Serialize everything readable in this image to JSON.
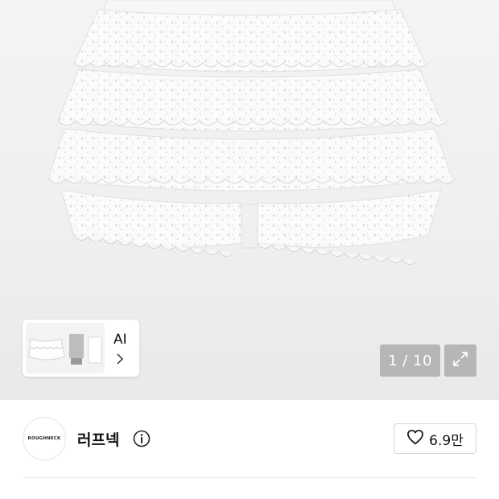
{
  "gallery": {
    "counter_text": "1 / 10",
    "ai_label": "AI",
    "expand_icon": "expand-icon"
  },
  "brand": {
    "logo_text": "ROUGHNECK",
    "name": "러프넥",
    "info_icon": "info-icon"
  },
  "like": {
    "icon": "heart-icon",
    "count": "6.9만"
  },
  "colors": {
    "hero_bg": "#efefef",
    "overlay_btn": "#969696",
    "text": "#111111"
  }
}
